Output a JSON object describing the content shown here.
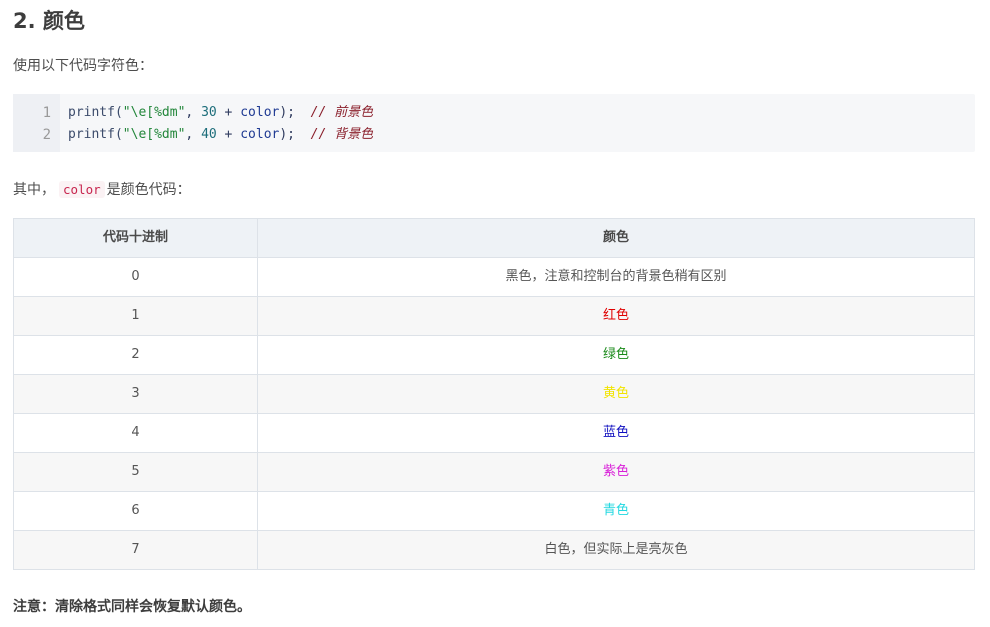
{
  "heading": "2. 颜色",
  "intro": "使用以下代码字符色：",
  "code": {
    "line_numbers": [
      "1",
      "2"
    ],
    "lines": [
      {
        "fn": "printf(",
        "str": "\"\\e[%dm\"",
        "sep1": ", ",
        "num": "30",
        "op": " + ",
        "var": "color",
        "end": ");  ",
        "comment": "// 前景色"
      },
      {
        "fn": "printf(",
        "str": "\"\\e[%dm\"",
        "sep1": ", ",
        "num": "40",
        "op": " + ",
        "var": "color",
        "end": ");  ",
        "comment": "// 背景色"
      }
    ]
  },
  "desc": {
    "prefix": "其中，",
    "code": "color",
    "suffix": "是颜色代码："
  },
  "table": {
    "headers": [
      "代码十进制",
      "颜色"
    ],
    "rows": [
      {
        "code": "0",
        "label": "黑色，注意和控制台的背景色稍有区别",
        "color": "#555555"
      },
      {
        "code": "1",
        "label": "红色",
        "color": "#e00000"
      },
      {
        "code": "2",
        "label": "绿色",
        "color": "#1a8a1a"
      },
      {
        "code": "3",
        "label": "黄色",
        "color": "#f2e400"
      },
      {
        "code": "4",
        "label": "蓝色",
        "color": "#1010c0"
      },
      {
        "code": "5",
        "label": "紫色",
        "color": "#d81ed8"
      },
      {
        "code": "6",
        "label": "青色",
        "color": "#22d8e0"
      },
      {
        "code": "7",
        "label": "白色，但实际上是亮灰色",
        "color": "#555555"
      }
    ]
  },
  "note": "注意：清除格式同样会恢复默认颜色。"
}
